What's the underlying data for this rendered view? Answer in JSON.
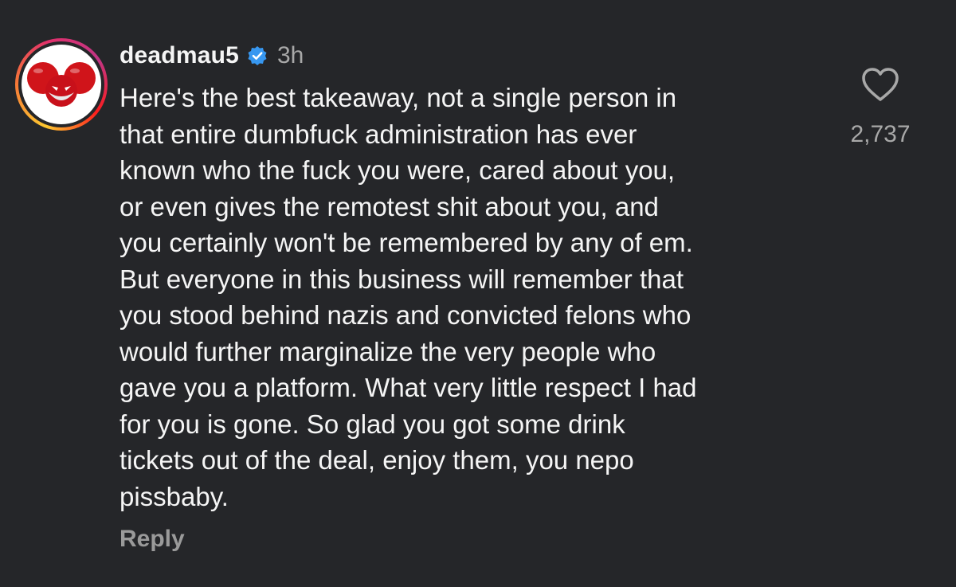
{
  "comment": {
    "username": "deadmau5",
    "time": "3h",
    "text": "Here's the best takeaway, not a single person in\nthat entire dumbfuck administration has ever\nknown who the fuck you were, cared about you,\nor even gives the remotest shit about you, and\nyou certainly won't be remembered by any of em.\nBut everyone in this business will remember that\nyou stood behind nazis and convicted felons who\nwould further marginalize the very people who\ngave you a platform. What very little respect I had\nfor you is gone.  So glad you got some drink\ntickets out of the deal, enjoy them, you nepo\npissbaby.",
    "reply_label": "Reply",
    "like_count": "2,737",
    "icons": {
      "verified": "verified-badge-icon",
      "like": "heart-outline-icon"
    }
  },
  "colors": {
    "background": "#252629",
    "text": "#f5f5f5",
    "muted": "#a8a8a8",
    "verified": "#3797f0",
    "avatar_red": "#d0141a"
  }
}
